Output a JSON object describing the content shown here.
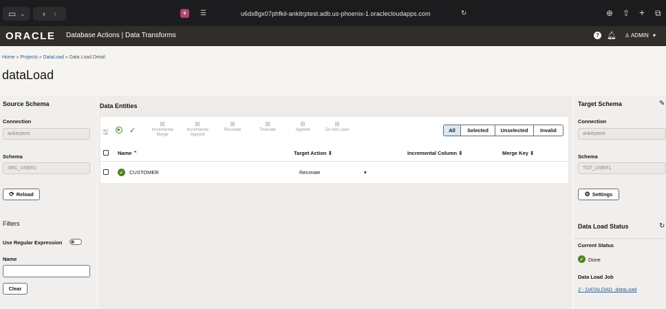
{
  "browser": {
    "url": "u6dx8gx07phfkil-ankitrptest.adb.us-phoenix-1.oraclecloudapps.com"
  },
  "header": {
    "logo": "ORACLE",
    "title": "Database Actions | Data Transforms",
    "user": "ADMIN"
  },
  "breadcrumb": {
    "home": "Home",
    "sep": "»",
    "projects": "Projects",
    "dataload": "DataLoad",
    "current": "Data Load Detail"
  },
  "page_title": "dataLoad",
  "source": {
    "title": "Source Schema",
    "connection_label": "Connection",
    "connection_value": "ankitrptest",
    "schema_label": "Schema",
    "schema_value": "SRC_USER1",
    "reload_label": "Reload",
    "filters_title": "Filters",
    "regex_label": "Use Regular Expression",
    "name_label": "Name",
    "name_value": "",
    "clear_label": "Clear"
  },
  "entities": {
    "title": "Data Entities",
    "tools": [
      "Incremental Merge",
      "Incremental Append",
      "Recreate",
      "Truncate",
      "Append",
      "Do Not Load"
    ],
    "filters": [
      "All",
      "Selected",
      "Unselected",
      "Invalid"
    ],
    "columns": {
      "name": "Name",
      "target_action": "Target Action",
      "incremental_column": "Incremental Column",
      "merge_key": "Merge Key"
    },
    "rows": [
      {
        "name": "CUSTOMER",
        "target_action": "Recreate",
        "incremental_column": "",
        "merge_key": ""
      }
    ]
  },
  "target": {
    "title": "Target Schema",
    "connection_label": "Connection",
    "connection_value": "ankitrptest",
    "schema_label": "Schema",
    "schema_value": "TGT_USER1",
    "settings_label": "Settings",
    "status_title": "Data Load Status",
    "current_status_label": "Current Status",
    "current_status_value": "Done",
    "job_label": "Data Load Job",
    "job_value": "2 - DATALOAD_dataLoad"
  },
  "colors": {
    "header_bg": "#312d2a",
    "success": "#508223",
    "link": "#2a5e8c",
    "selected_filter": "#dbe9f5"
  }
}
